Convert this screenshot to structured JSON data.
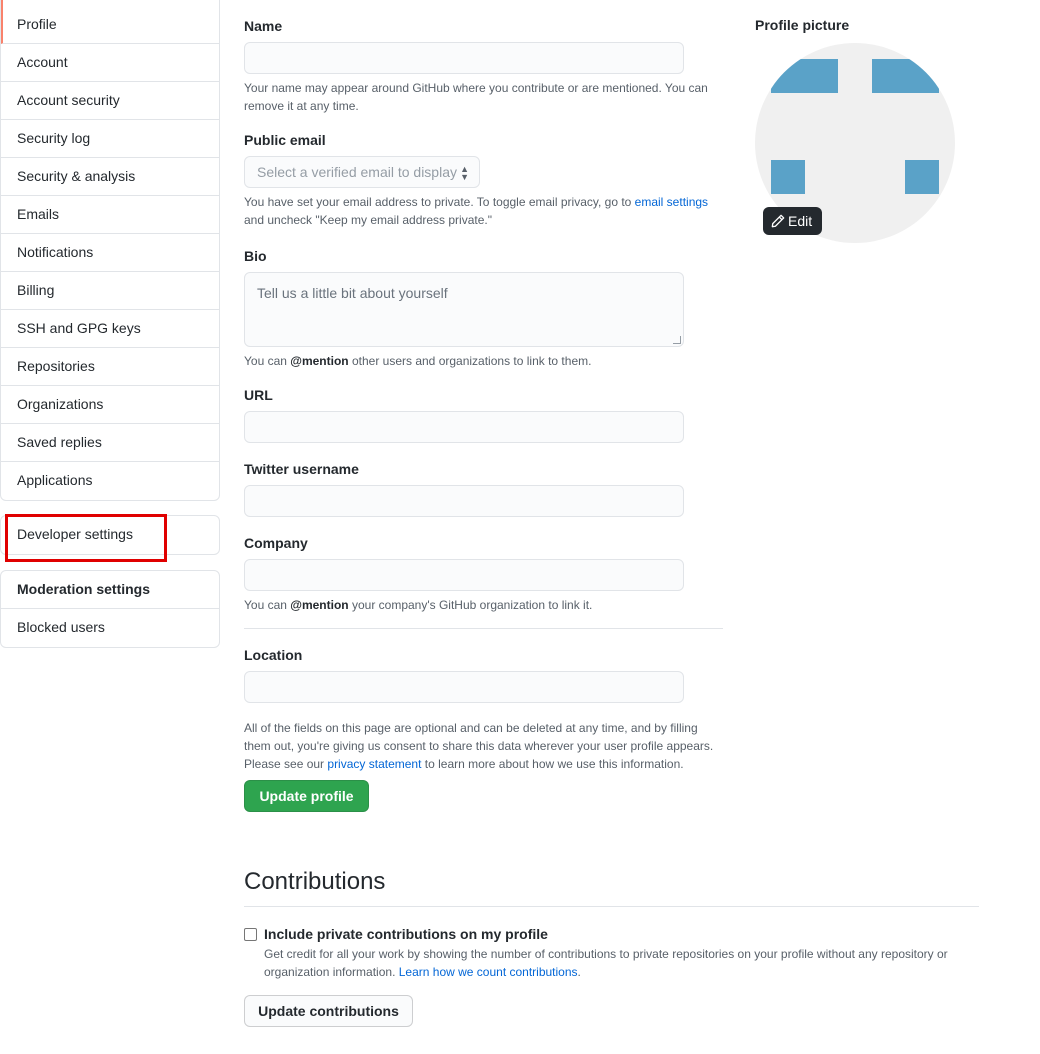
{
  "sidebar": {
    "main_items": [
      {
        "label": "Profile"
      },
      {
        "label": "Account"
      },
      {
        "label": "Account security"
      },
      {
        "label": "Security log"
      },
      {
        "label": "Security & analysis"
      },
      {
        "label": "Emails"
      },
      {
        "label": "Notifications"
      },
      {
        "label": "Billing"
      },
      {
        "label": "SSH and GPG keys"
      },
      {
        "label": "Repositories"
      },
      {
        "label": "Organizations"
      },
      {
        "label": "Saved replies"
      },
      {
        "label": "Applications"
      }
    ],
    "developer_settings": "Developer settings",
    "moderation_heading": "Moderation settings",
    "blocked_users": "Blocked users"
  },
  "form": {
    "name_label": "Name",
    "name_value": "",
    "name_note": "Your name may appear around GitHub where you contribute or are mentioned. You can remove it at any time.",
    "public_email_label": "Public email",
    "public_email_select": "Select a verified email to display",
    "public_email_note_pre": "You have set your email address to private. To toggle email privacy, go to ",
    "public_email_note_link": "email settings",
    "public_email_note_post": " and uncheck \"Keep my email address private.\"",
    "bio_label": "Bio",
    "bio_placeholder": "Tell us a little bit about yourself",
    "bio_note_pre": "You can ",
    "bio_note_mention": "@mention",
    "bio_note_post": " other users and organizations to link to them.",
    "url_label": "URL",
    "twitter_label": "Twitter username",
    "company_label": "Company",
    "company_note_pre": "You can ",
    "company_note_mention": "@mention",
    "company_note_post": " your company's GitHub organization to link it.",
    "location_label": "Location",
    "privacy_note_pre": "All of the fields on this page are optional and can be deleted at any time, and by filling them out, you're giving us consent to share this data wherever your user profile appears. Please see our ",
    "privacy_note_link": "privacy statement",
    "privacy_note_post": " to learn more about how we use this information.",
    "update_button": "Update profile"
  },
  "contributions": {
    "title": "Contributions",
    "checkbox_label": "Include private contributions on my profile",
    "checkbox_checked": false,
    "note_pre": "Get credit for all your work by showing the number of contributions to private repositories on your profile without any repository or organization information. ",
    "note_link": "Learn how we count contributions",
    "note_post": ".",
    "update_button": "Update contributions"
  },
  "profile_picture": {
    "label": "Profile picture",
    "edit_label": "Edit",
    "edit_icon": "pencil-icon",
    "identicon_color": "#5aa2c8",
    "avatar_bg": "#f0f0f0"
  },
  "colors": {
    "primary_button": "#2ea44f",
    "link": "#0366d6",
    "selected_indicator": "#f9826c",
    "highlight_annotation": "#e00000"
  }
}
